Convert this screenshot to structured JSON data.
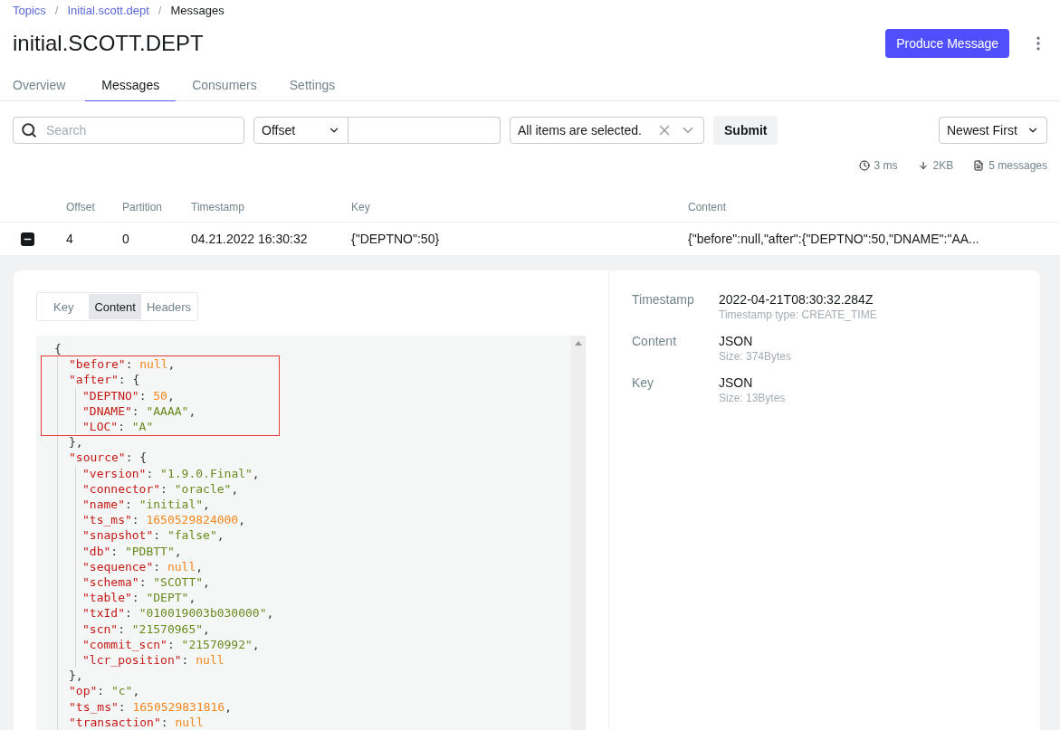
{
  "breadcrumbs": [
    {
      "label": "Topics",
      "link": true
    },
    {
      "label": "Initial.scott.dept",
      "link": true
    },
    {
      "label": "Messages",
      "link": false
    }
  ],
  "separator": "/",
  "title": "initial.SCOTT.DEPT",
  "actions": {
    "primary": "Produce Message"
  },
  "tabs": [
    {
      "label": "Overview",
      "selected": false
    },
    {
      "label": "Messages",
      "selected": true
    },
    {
      "label": "Consumers",
      "selected": false
    },
    {
      "label": "Settings",
      "selected": false
    }
  ],
  "filters": {
    "search": {
      "placeholder": "Search"
    },
    "seek_type": "Offset",
    "partitions": "All items are selected.",
    "submit": "Submit",
    "sort": "Newest First"
  },
  "stats": [
    {
      "kind": "time",
      "text": "3 ms"
    },
    {
      "kind": "size",
      "text": "2KB"
    },
    {
      "kind": "count",
      "text": "5 messages"
    }
  ],
  "table": {
    "columns": [
      "Offset",
      "Partition",
      "Timestamp",
      "Key",
      "Content"
    ],
    "rows": [
      {
        "expanded": true,
        "cells": [
          "4",
          "0",
          "04.21.2022 16:30:32",
          "{\"DEPTNO\":50}",
          "{\"before\":null,\"after\":{\"DEPTNO\":50,\"DNAME\":\"AA..."
        ]
      }
    ]
  },
  "detail": {
    "tabs": [
      {
        "label": "Key",
        "selected": false
      },
      {
        "label": "Content",
        "selected": true
      },
      {
        "label": "Headers",
        "selected": false
      }
    ],
    "code": {
      "annotation": {
        "kind": "red-box"
      },
      "open": "{",
      "entries": [
        {
          "tokens": [
            {
              "kind": "key",
              "text": "\"before\""
            },
            {
              "kind": "punct",
              "text": ": "
            },
            {
              "kind": "number",
              "text": "null"
            },
            {
              "kind": "punct",
              "text": ","
            }
          ]
        },
        {
          "tokens": [
            {
              "kind": "key",
              "text": "\"after\""
            },
            {
              "kind": "punct",
              "text": ": {"
            }
          ],
          "children": [
            {
              "tokens": [
                {
                  "kind": "key",
                  "text": "\"DEPTNO\""
                },
                {
                  "kind": "punct",
                  "text": ": "
                },
                {
                  "kind": "number",
                  "text": "50"
                },
                {
                  "kind": "punct",
                  "text": ","
                }
              ]
            },
            {
              "tokens": [
                {
                  "kind": "key",
                  "text": "\"DNAME\""
                },
                {
                  "kind": "punct",
                  "text": ": "
                },
                {
                  "kind": "string",
                  "text": "\"AAAA\""
                },
                {
                  "kind": "punct",
                  "text": ","
                }
              ]
            },
            {
              "tokens": [
                {
                  "kind": "key",
                  "text": "\"LOC\""
                },
                {
                  "kind": "punct",
                  "text": ": "
                },
                {
                  "kind": "string",
                  "text": "\"A\""
                }
              ]
            }
          ],
          "close": "},"
        },
        {
          "tokens": [
            {
              "kind": "key",
              "text": "\"source\""
            },
            {
              "kind": "punct",
              "text": ": {"
            }
          ],
          "children": [
            {
              "tokens": [
                {
                  "kind": "key",
                  "text": "\"version\""
                },
                {
                  "kind": "punct",
                  "text": ": "
                },
                {
                  "kind": "string",
                  "text": "\"1.9.0.Final\""
                },
                {
                  "kind": "punct",
                  "text": ","
                }
              ]
            },
            {
              "tokens": [
                {
                  "kind": "key",
                  "text": "\"connector\""
                },
                {
                  "kind": "punct",
                  "text": ": "
                },
                {
                  "kind": "string",
                  "text": "\"oracle\""
                },
                {
                  "kind": "punct",
                  "text": ","
                }
              ]
            },
            {
              "tokens": [
                {
                  "kind": "key",
                  "text": "\"name\""
                },
                {
                  "kind": "punct",
                  "text": ": "
                },
                {
                  "kind": "string",
                  "text": "\"initial\""
                },
                {
                  "kind": "punct",
                  "text": ","
                }
              ]
            },
            {
              "tokens": [
                {
                  "kind": "key",
                  "text": "\"ts_ms\""
                },
                {
                  "kind": "punct",
                  "text": ": "
                },
                {
                  "kind": "number",
                  "text": "1650529824000"
                },
                {
                  "kind": "punct",
                  "text": ","
                }
              ]
            },
            {
              "tokens": [
                {
                  "kind": "key",
                  "text": "\"snapshot\""
                },
                {
                  "kind": "punct",
                  "text": ": "
                },
                {
                  "kind": "string",
                  "text": "\"false\""
                },
                {
                  "kind": "punct",
                  "text": ","
                }
              ]
            },
            {
              "tokens": [
                {
                  "kind": "key",
                  "text": "\"db\""
                },
                {
                  "kind": "punct",
                  "text": ": "
                },
                {
                  "kind": "string",
                  "text": "\"PDBTT\""
                },
                {
                  "kind": "punct",
                  "text": ","
                }
              ]
            },
            {
              "tokens": [
                {
                  "kind": "key",
                  "text": "\"sequence\""
                },
                {
                  "kind": "punct",
                  "text": ": "
                },
                {
                  "kind": "number",
                  "text": "null"
                },
                {
                  "kind": "punct",
                  "text": ","
                }
              ]
            },
            {
              "tokens": [
                {
                  "kind": "key",
                  "text": "\"schema\""
                },
                {
                  "kind": "punct",
                  "text": ": "
                },
                {
                  "kind": "string",
                  "text": "\"SCOTT\""
                },
                {
                  "kind": "punct",
                  "text": ","
                }
              ]
            },
            {
              "tokens": [
                {
                  "kind": "key",
                  "text": "\"table\""
                },
                {
                  "kind": "punct",
                  "text": ": "
                },
                {
                  "kind": "string",
                  "text": "\"DEPT\""
                },
                {
                  "kind": "punct",
                  "text": ","
                }
              ]
            },
            {
              "tokens": [
                {
                  "kind": "key",
                  "text": "\"txId\""
                },
                {
                  "kind": "punct",
                  "text": ": "
                },
                {
                  "kind": "string",
                  "text": "\"010019003b030000\""
                },
                {
                  "kind": "punct",
                  "text": ","
                }
              ]
            },
            {
              "tokens": [
                {
                  "kind": "key",
                  "text": "\"scn\""
                },
                {
                  "kind": "punct",
                  "text": ": "
                },
                {
                  "kind": "string",
                  "text": "\"21570965\""
                },
                {
                  "kind": "punct",
                  "text": ","
                }
              ]
            },
            {
              "tokens": [
                {
                  "kind": "key",
                  "text": "\"commit_scn\""
                },
                {
                  "kind": "punct",
                  "text": ": "
                },
                {
                  "kind": "string",
                  "text": "\"21570992\""
                },
                {
                  "kind": "punct",
                  "text": ","
                }
              ]
            },
            {
              "tokens": [
                {
                  "kind": "key",
                  "text": "\"lcr_position\""
                },
                {
                  "kind": "punct",
                  "text": ": "
                },
                {
                  "kind": "number",
                  "text": "null"
                }
              ]
            }
          ],
          "close": "},"
        },
        {
          "tokens": [
            {
              "kind": "key",
              "text": "\"op\""
            },
            {
              "kind": "punct",
              "text": ": "
            },
            {
              "kind": "string",
              "text": "\"c\""
            },
            {
              "kind": "punct",
              "text": ","
            }
          ]
        },
        {
          "tokens": [
            {
              "kind": "key",
              "text": "\"ts_ms\""
            },
            {
              "kind": "punct",
              "text": ": "
            },
            {
              "kind": "number",
              "text": "1650529831816"
            },
            {
              "kind": "punct",
              "text": ","
            }
          ]
        },
        {
          "tokens": [
            {
              "kind": "key",
              "text": "\"transaction\""
            },
            {
              "kind": "punct",
              "text": ": "
            },
            {
              "kind": "number",
              "text": "null"
            }
          ]
        }
      ]
    },
    "meta": [
      {
        "label": "Timestamp",
        "value": "2022-04-21T08:30:32.284Z",
        "note": "Timestamp type: CREATE_TIME"
      },
      {
        "label": "Content",
        "value": "JSON",
        "note": "Size: 374Bytes"
      },
      {
        "label": "Key",
        "value": "JSON",
        "note": "Size: 13Bytes"
      }
    ]
  }
}
